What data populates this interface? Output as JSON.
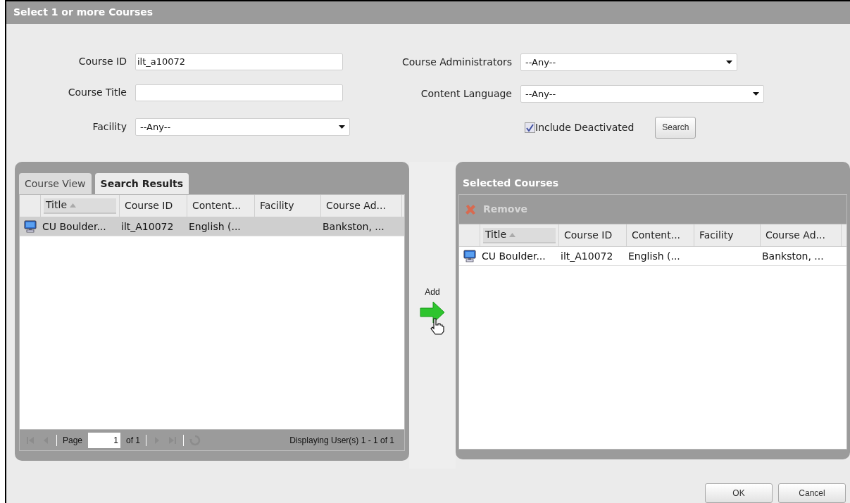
{
  "dialog": {
    "title": "Select 1 or more Courses"
  },
  "form": {
    "course_id": {
      "label": "Course ID",
      "value": "ilt_a10072"
    },
    "course_title": {
      "label": "Course Title"
    },
    "facility": {
      "label": "Facility",
      "value": "--Any--"
    },
    "course_administrators": {
      "label": "Course Administrators",
      "value": "--Any--"
    },
    "content_language": {
      "label": "Content Language",
      "value": "--Any--"
    },
    "include_deactivated": {
      "label": "Include Deactivated",
      "checked": true
    },
    "search_button": "Search"
  },
  "left_panel": {
    "tabs": [
      {
        "label": "Course View",
        "selected": false
      },
      {
        "label": "Search Results",
        "selected": true
      }
    ],
    "columns": [
      {
        "label": "Title",
        "sorted": true
      },
      {
        "label": "Course ID",
        "sorted": false
      },
      {
        "label": "Content...",
        "sorted": false
      },
      {
        "label": "Facility",
        "sorted": false
      },
      {
        "label": "Course Ad...",
        "sorted": false
      }
    ],
    "rows": [
      {
        "cells": [
          "CU Boulder...",
          "ilt_A10072",
          "English (...",
          "",
          "Bankston, ..."
        ],
        "selected": true
      }
    ],
    "pager": {
      "page_label": "Page",
      "page_value": "1",
      "of_label": "of 1",
      "status": "Displaying User(s) 1 - 1 of 1"
    }
  },
  "add": {
    "label": "Add"
  },
  "right_panel": {
    "title": "Selected Courses",
    "remove_button": {
      "label": "Remove",
      "disabled": true
    },
    "columns": [
      {
        "label": "Title",
        "sorted": true
      },
      {
        "label": "Course ID",
        "sorted": false
      },
      {
        "label": "Content...",
        "sorted": false
      },
      {
        "label": "Facility",
        "sorted": false
      },
      {
        "label": "Course Ad...",
        "sorted": false
      }
    ],
    "rows": [
      {
        "cells": [
          "CU Boulder...",
          "ilt_A10072",
          "English (...",
          "",
          "Bankston, ..."
        ],
        "selected": false
      }
    ]
  },
  "buttons": [
    "OK",
    "Cancel"
  ]
}
